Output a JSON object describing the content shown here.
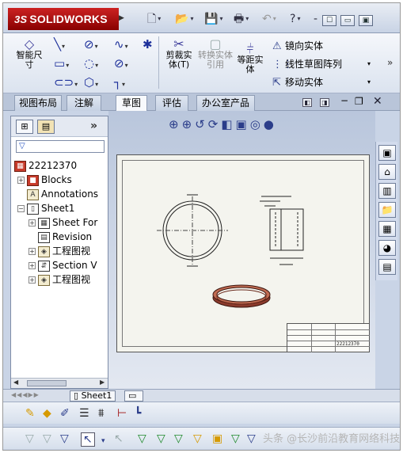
{
  "app": {
    "brand": "SOLIDWORKS",
    "brand_prefix": "3S"
  },
  "quick_access": {
    "items": [
      {
        "name": "new-icon",
        "glyph": "🗋"
      },
      {
        "name": "open-icon",
        "glyph": "📂"
      },
      {
        "name": "save-icon",
        "glyph": "💾"
      },
      {
        "name": "print-icon",
        "glyph": "🖶"
      },
      {
        "name": "undo-icon",
        "glyph": "↶"
      },
      {
        "name": "help-icon",
        "glyph": "?"
      }
    ],
    "window_buttons": [
      "☐",
      "▭",
      "▣"
    ]
  },
  "ribbon": {
    "smart_dimension": "智能尺寸",
    "trim_entities": "剪裁实体(T)",
    "convert_entities": "转换实体引用",
    "offset_entities": "等距实体",
    "mirror_entities": "镜向实体",
    "linear_pattern": "线性草图阵列",
    "move_entities": "移动实体"
  },
  "tabs": [
    {
      "label": "视图布局",
      "active": false
    },
    {
      "label": "注解",
      "active": false
    },
    {
      "label": "草图",
      "active": true
    },
    {
      "label": "评估",
      "active": false
    },
    {
      "label": "办公室产品",
      "active": false
    }
  ],
  "feature_tree": {
    "root": "22212370",
    "items": [
      {
        "label": "Blocks",
        "expand": "+"
      },
      {
        "label": "Annotations",
        "expand": ""
      },
      {
        "label": "Sheet1",
        "expand": "−"
      },
      {
        "label": "Sheet For",
        "expand": "+"
      },
      {
        "label": "Revision",
        "expand": ""
      },
      {
        "label": "工程图视",
        "expand": "+"
      },
      {
        "label": "Section V",
        "expand": "+"
      },
      {
        "label": "工程图视",
        "expand": "+"
      }
    ]
  },
  "drawing": {
    "title_block_number": "22212370"
  },
  "sheet_tabs": {
    "active": "Sheet1"
  },
  "watermark": "头条 @长沙前沿教育网络科技"
}
